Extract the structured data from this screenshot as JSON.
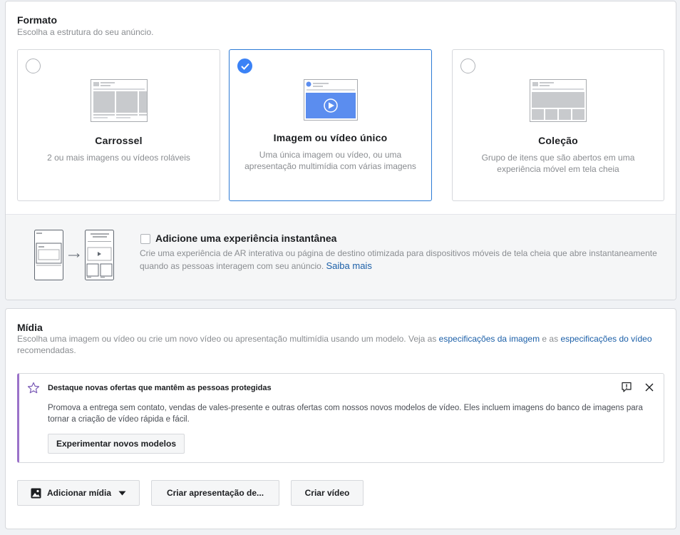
{
  "formato": {
    "title": "Formato",
    "subtitle": "Escolha a estrutura do seu anúncio.",
    "cards": [
      {
        "title": "Carrossel",
        "desc": "2 ou mais imagens ou vídeos roláveis",
        "selected": false,
        "icon": "carousel-illustration"
      },
      {
        "title": "Imagem ou vídeo único",
        "desc": "Uma única imagem ou vídeo, ou uma apresentação multimídia com várias imagens",
        "selected": true,
        "icon": "single-video-illustration"
      },
      {
        "title": "Coleção",
        "desc": "Grupo de itens que são abertos em uma experiência móvel em tela cheia",
        "selected": false,
        "icon": "collection-illustration"
      }
    ],
    "instant": {
      "label": "Adicione uma experiência instantânea",
      "checked": false,
      "desc": "Crie uma experiência de AR interativa ou página de destino otimizada para dispositivos móveis de tela cheia que abre instantaneamente quando as pessoas interagem com seu anúncio.",
      "link": "Saiba mais"
    }
  },
  "midia": {
    "title": "Mídia",
    "subtitle_pre": "Escolha uma imagem ou vídeo ou crie um novo vídeo ou apresentação multimídia usando um modelo. Veja as ",
    "link1": "especificações da imagem",
    "subtitle_mid": " e as ",
    "link2": "especificações do vídeo",
    "subtitle_post": " recomendadas.",
    "notice": {
      "title": "Destaque novas ofertas que mantêm as pessoas protegidas",
      "body": "Promova a entrega sem contato, vendas de vales-presente e outras ofertas com nossos novos modelos de vídeo. Eles incluem imagens do banco de imagens para tornar a criação de vídeo rápida e fácil.",
      "button": "Experimentar novos modelos"
    },
    "buttons": {
      "add_media": "Adicionar mídia",
      "create_slideshow": "Criar apresentação de...",
      "create_video": "Criar vídeo"
    }
  },
  "colors": {
    "accent": "#3b82f6",
    "link": "#1b5fa8",
    "notice_bar": "#9b72c9"
  }
}
